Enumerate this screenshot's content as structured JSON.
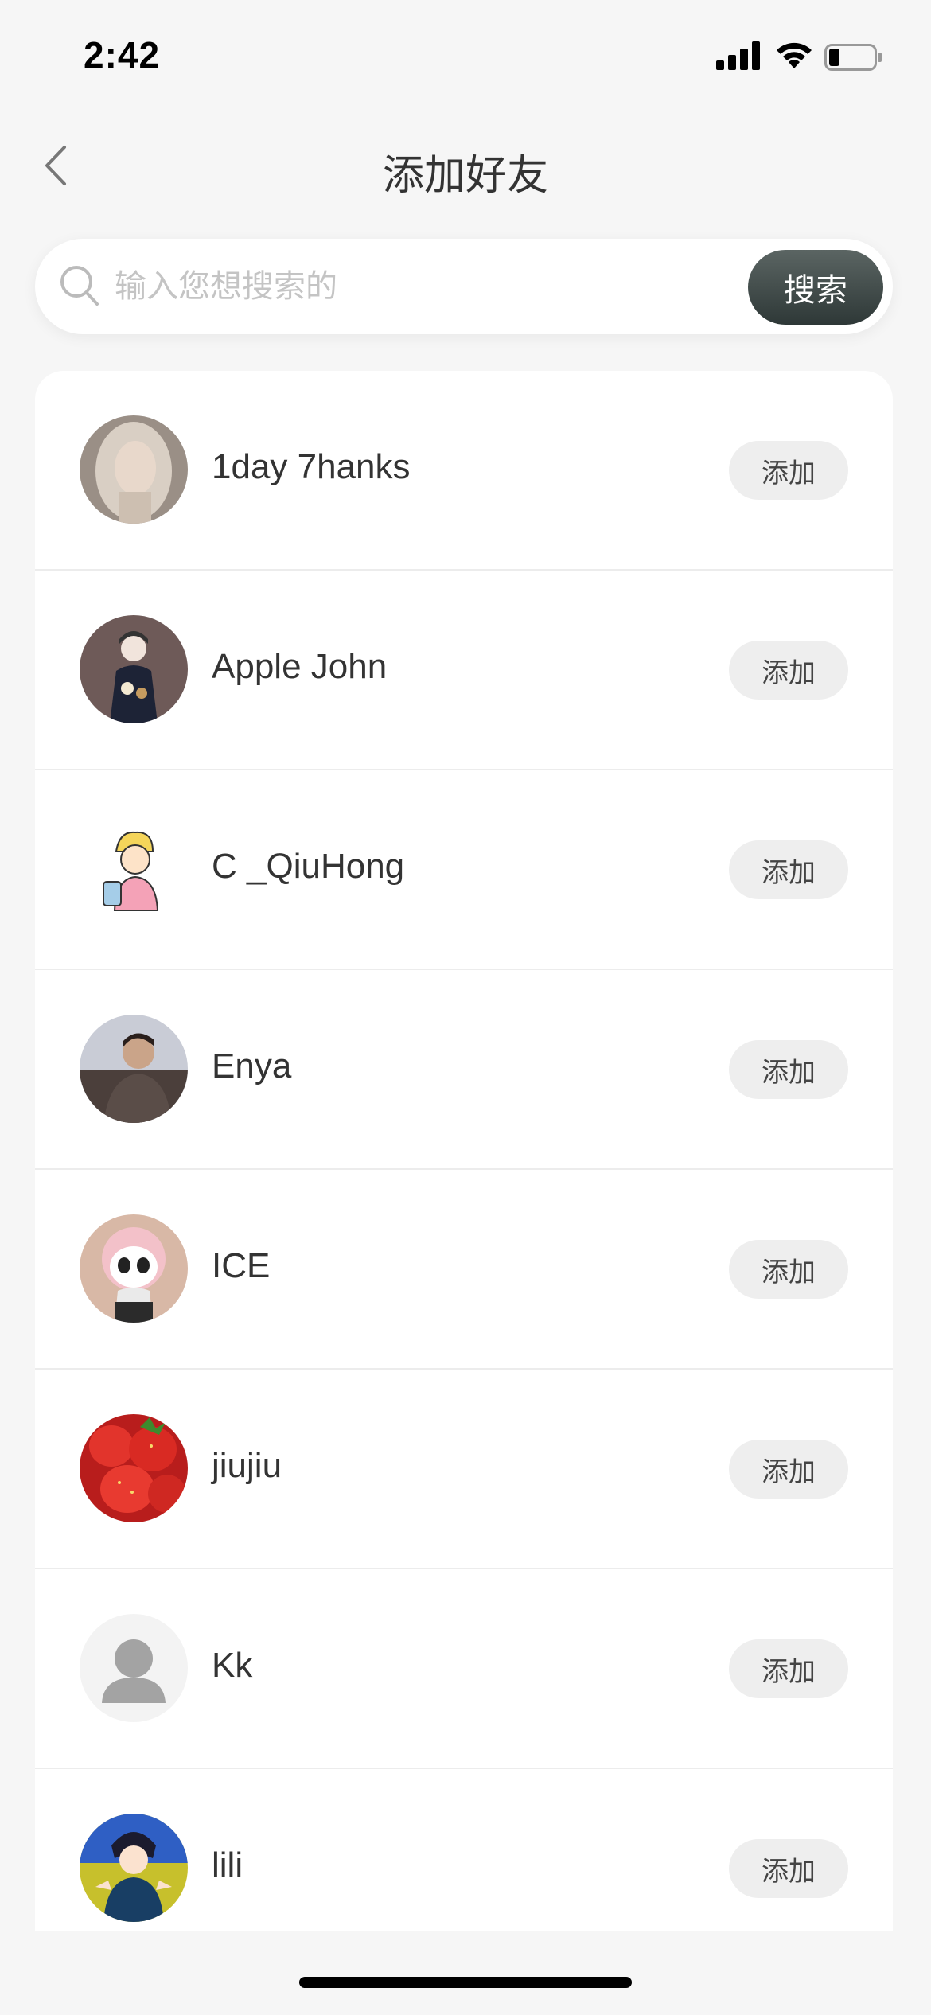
{
  "status_bar": {
    "time": "2:42"
  },
  "header": {
    "title": "添加好友"
  },
  "search": {
    "placeholder": "输入您想搜索的",
    "button_label": "搜索"
  },
  "friends": [
    {
      "name": "1day 7hanks",
      "add_label": "添加",
      "avatar": "avatar-photo-woman"
    },
    {
      "name": "Apple John",
      "add_label": "添加",
      "avatar": "avatar-illustration-girl"
    },
    {
      "name": "C _QiuHong",
      "add_label": "添加",
      "avatar": "avatar-cartoon-boy"
    },
    {
      "name": "Enya",
      "add_label": "添加",
      "avatar": "avatar-photo-man"
    },
    {
      "name": "ICE",
      "add_label": "添加",
      "avatar": "avatar-panda-toy"
    },
    {
      "name": "jiujiu",
      "add_label": "添加",
      "avatar": "avatar-strawberries"
    },
    {
      "name": "Kk",
      "add_label": "添加",
      "avatar": "avatar-default-person"
    },
    {
      "name": "lili",
      "add_label": "添加",
      "avatar": "avatar-anime-boy"
    }
  ],
  "colors": {
    "background": "#f6f6f6",
    "search_button": "#3a4443",
    "add_button_bg": "#eeeeee",
    "text": "#333333"
  }
}
